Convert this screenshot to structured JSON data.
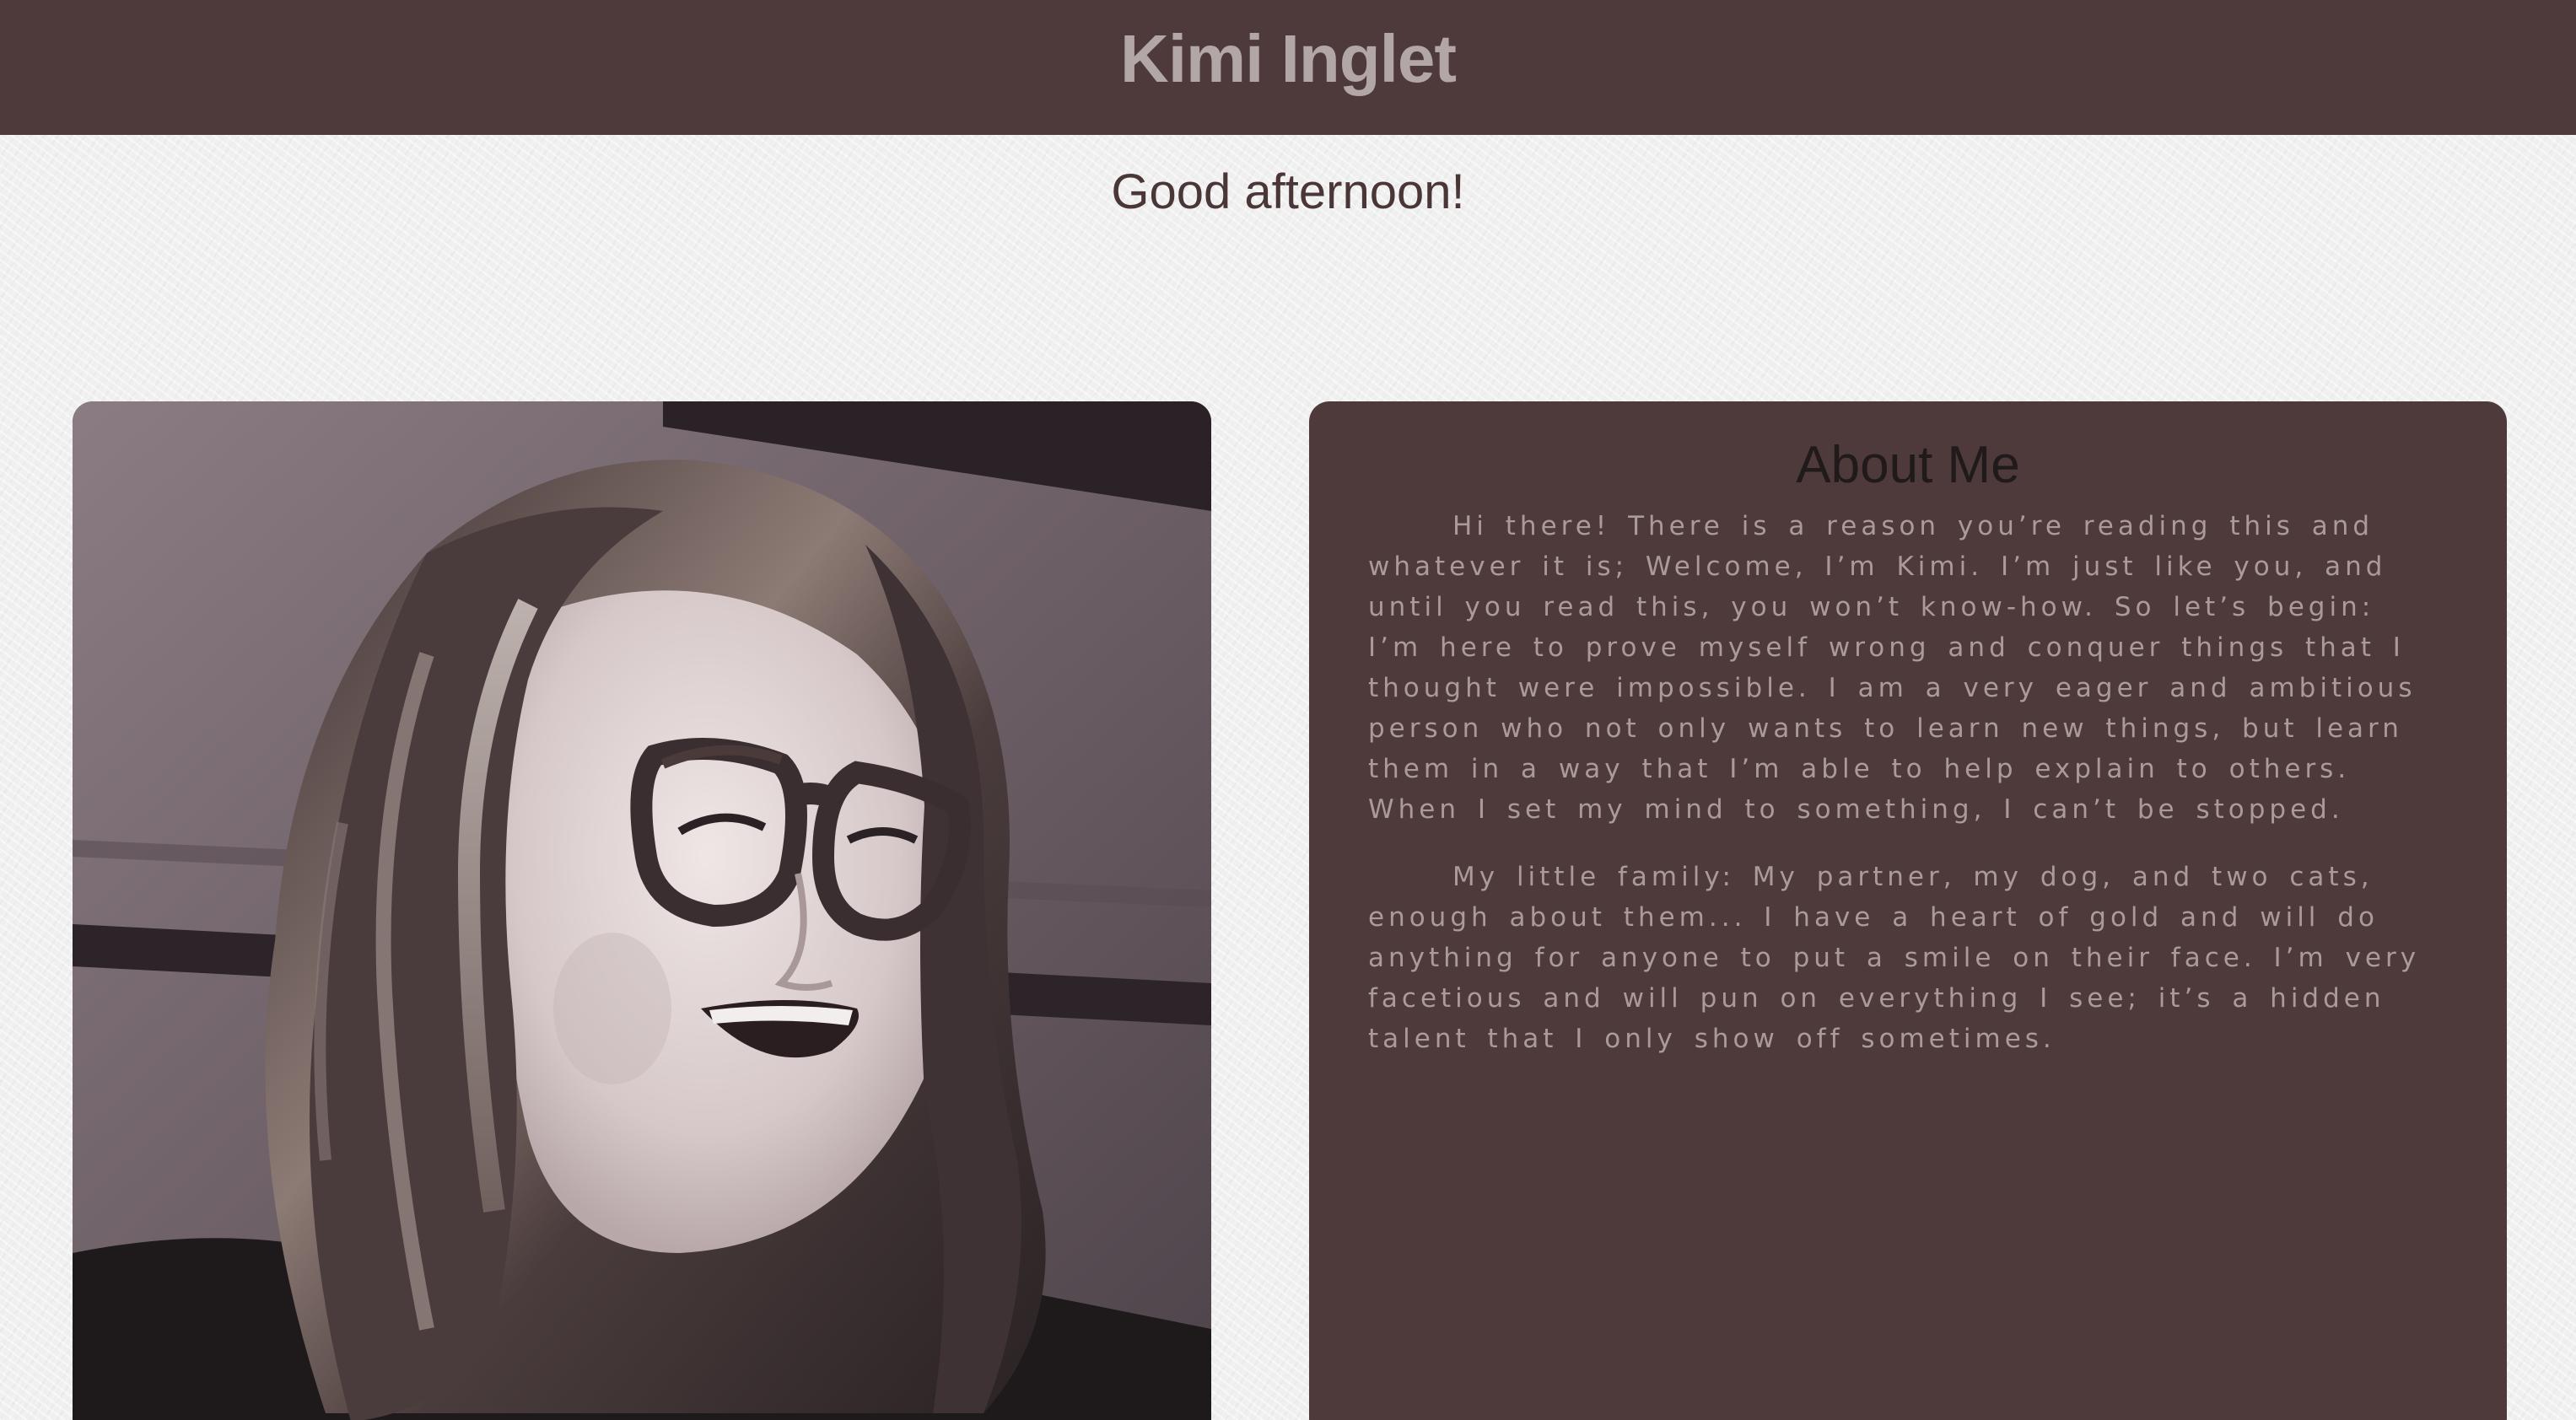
{
  "header": {
    "title": "Kimi Inglet"
  },
  "greeting": "Good afternoon!",
  "photo": {
    "icon": "portrait-photo"
  },
  "about": {
    "title": "About Me",
    "paragraphs": [
      "Hi there! There is a reason you’re reading this and whatever it is; Welcome, I’m Kimi. I’m just like you, and until you read this, you won’t know-how. So let’s begin: I’m here to prove myself wrong and conquer things that I thought were impossible. I am a very eager and ambitious person who not only wants to learn new things, but learn them in a way that I’m able to help explain to others. When I set my mind to something, I can’t be stopped.",
      "My little family: My partner, my dog, and two cats, enough about them... I have a heart of gold and will do anything for anyone to put a smile on their face. I’m very facetious and will pun on everything I see; it’s a hidden talent that I only show off sometimes."
    ]
  },
  "colors": {
    "header_bg": "#4e3a3a",
    "header_text": "#b2a6a6",
    "card_bg": "#4e3a3a",
    "body_text": "#aa9a9a",
    "page_bg": "#efefef"
  }
}
